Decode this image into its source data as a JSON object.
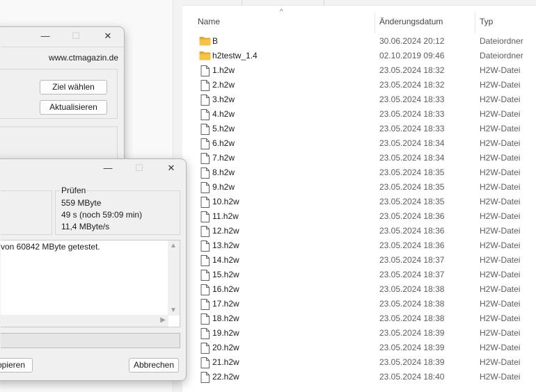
{
  "explorer": {
    "columns": {
      "name": "Name",
      "date": "Änderungsdatum",
      "type": "Typ"
    },
    "rows": [
      {
        "name": "B",
        "date": "30.06.2024 20:12",
        "type": "Dateiordner",
        "kind": "folder"
      },
      {
        "name": "h2testw_1.4",
        "date": "02.10.2019 09:46",
        "type": "Dateiordner",
        "kind": "folder"
      },
      {
        "name": "1.h2w",
        "date": "23.05.2024 18:32",
        "type": "H2W-Datei",
        "kind": "file"
      },
      {
        "name": "2.h2w",
        "date": "23.05.2024 18:32",
        "type": "H2W-Datei",
        "kind": "file"
      },
      {
        "name": "3.h2w",
        "date": "23.05.2024 18:33",
        "type": "H2W-Datei",
        "kind": "file"
      },
      {
        "name": "4.h2w",
        "date": "23.05.2024 18:33",
        "type": "H2W-Datei",
        "kind": "file"
      },
      {
        "name": "5.h2w",
        "date": "23.05.2024 18:33",
        "type": "H2W-Datei",
        "kind": "file"
      },
      {
        "name": "6.h2w",
        "date": "23.05.2024 18:34",
        "type": "H2W-Datei",
        "kind": "file"
      },
      {
        "name": "7.h2w",
        "date": "23.05.2024 18:34",
        "type": "H2W-Datei",
        "kind": "file"
      },
      {
        "name": "8.h2w",
        "date": "23.05.2024 18:35",
        "type": "H2W-Datei",
        "kind": "file"
      },
      {
        "name": "9.h2w",
        "date": "23.05.2024 18:35",
        "type": "H2W-Datei",
        "kind": "file"
      },
      {
        "name": "10.h2w",
        "date": "23.05.2024 18:35",
        "type": "H2W-Datei",
        "kind": "file"
      },
      {
        "name": "11.h2w",
        "date": "23.05.2024 18:36",
        "type": "H2W-Datei",
        "kind": "file"
      },
      {
        "name": "12.h2w",
        "date": "23.05.2024 18:36",
        "type": "H2W-Datei",
        "kind": "file"
      },
      {
        "name": "13.h2w",
        "date": "23.05.2024 18:36",
        "type": "H2W-Datei",
        "kind": "file"
      },
      {
        "name": "14.h2w",
        "date": "23.05.2024 18:37",
        "type": "H2W-Datei",
        "kind": "file"
      },
      {
        "name": "15.h2w",
        "date": "23.05.2024 18:37",
        "type": "H2W-Datei",
        "kind": "file"
      },
      {
        "name": "16.h2w",
        "date": "23.05.2024 18:38",
        "type": "H2W-Datei",
        "kind": "file"
      },
      {
        "name": "17.h2w",
        "date": "23.05.2024 18:38",
        "type": "H2W-Datei",
        "kind": "file"
      },
      {
        "name": "18.h2w",
        "date": "23.05.2024 18:38",
        "type": "H2W-Datei",
        "kind": "file"
      },
      {
        "name": "19.h2w",
        "date": "23.05.2024 18:39",
        "type": "H2W-Datei",
        "kind": "file"
      },
      {
        "name": "20.h2w",
        "date": "23.05.2024 18:39",
        "type": "H2W-Datei",
        "kind": "file"
      },
      {
        "name": "21.h2w",
        "date": "23.05.2024 18:39",
        "type": "H2W-Datei",
        "kind": "file"
      },
      {
        "name": "22.h2w",
        "date": "23.05.2024 18:40",
        "type": "H2W-Datei",
        "kind": "file"
      }
    ]
  },
  "main_dialog": {
    "website": "www.ctmagazin.de",
    "target_button": "Ziel wählen",
    "refresh_button": "Aktualisieren"
  },
  "progress_dialog": {
    "verify_group": {
      "label": "Prüfen",
      "size": "559 MByte",
      "time": "49 s (noch 59:09 min)",
      "speed": "11,4 MByte/s"
    },
    "log_text": "von 60842 MByte getestet.",
    "copy_button": "opieren",
    "cancel_button": "Abbrechen"
  },
  "colors": {
    "folder": "#f8c244",
    "folder_dark": "#e3a823",
    "dialog_bg": "#f0f0f0"
  }
}
